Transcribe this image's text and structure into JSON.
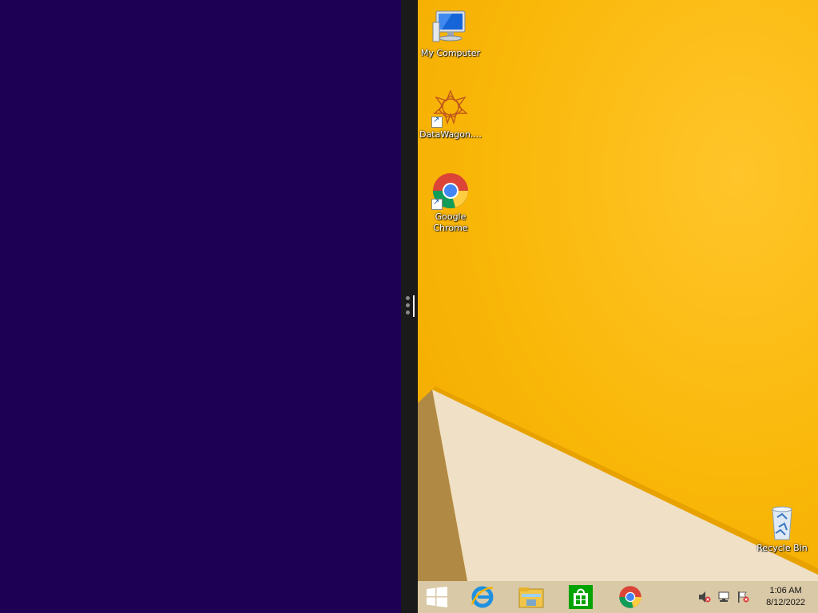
{
  "desktop": {
    "icons": [
      {
        "label": "My Computer",
        "icon": "computer-icon"
      },
      {
        "label": "DataWagon....",
        "icon": "datawagon-icon"
      },
      {
        "label": "Google Chrome",
        "icon": "chrome-icon"
      },
      {
        "label": "Recycle Bin",
        "icon": "recycle-bin-icon"
      }
    ]
  },
  "taskbar": {
    "pinned": [
      "start-icon",
      "internet-explorer-icon",
      "file-explorer-icon",
      "store-icon",
      "chrome-icon"
    ],
    "tray": [
      "volume-muted-icon",
      "network-icon",
      "action-center-flag-icon"
    ],
    "time": "1:06 AM",
    "date": "8/12/2022"
  },
  "colors": {
    "left_pane": "#1d0053",
    "divider": "#1a1a1a",
    "wallpaper": "#f9b708"
  }
}
